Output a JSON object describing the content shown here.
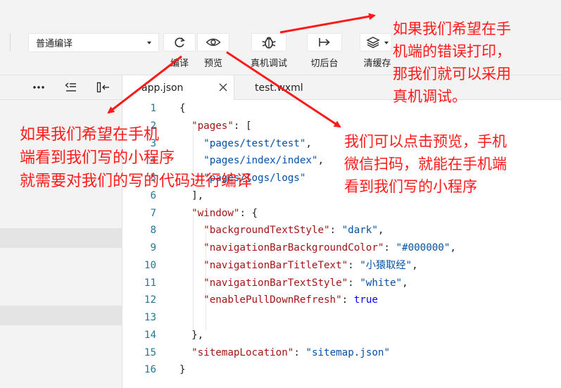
{
  "toolbar": {
    "compile_mode": "普通编译",
    "buttons": [
      {
        "id": "compile",
        "label": "编译",
        "icon": "refresh-icon"
      },
      {
        "id": "preview",
        "label": "预览",
        "icon": "eye-icon"
      },
      {
        "id": "remote_debug",
        "label": "真机调试",
        "icon": "bug-icon"
      },
      {
        "id": "background",
        "label": "切后台",
        "icon": "switch-background-icon"
      },
      {
        "id": "clear_cache",
        "label": "清缓存",
        "icon": "layers-icon"
      }
    ]
  },
  "left_panel": {
    "icons": [
      "more-icon",
      "outdent-icon",
      "collapse-panel-icon"
    ]
  },
  "tabs": [
    {
      "label": "app.json",
      "active": true
    },
    {
      "label": "test.wxml",
      "active": false
    }
  ],
  "code": [
    {
      "n": "1",
      "tokens": [
        [
          "p",
          "{"
        ]
      ]
    },
    {
      "n": "2",
      "tokens": [
        [
          "p",
          "  "
        ],
        [
          "k",
          "\"pages\""
        ],
        [
          "p",
          ": ["
        ]
      ]
    },
    {
      "n": "3",
      "tokens": [
        [
          "p",
          "    "
        ],
        [
          "s",
          "\"pages/test/test\""
        ],
        [
          "p",
          ","
        ]
      ]
    },
    {
      "n": "4",
      "tokens": [
        [
          "p",
          "    "
        ],
        [
          "s",
          "\"pages/index/index\""
        ],
        [
          "p",
          ","
        ]
      ]
    },
    {
      "n": "5",
      "tokens": [
        [
          "p",
          "    "
        ],
        [
          "s",
          "\"pages/logs/logs\""
        ]
      ]
    },
    {
      "n": "6",
      "tokens": [
        [
          "p",
          "  ],"
        ]
      ]
    },
    {
      "n": "7",
      "tokens": [
        [
          "p",
          "  "
        ],
        [
          "k",
          "\"window\""
        ],
        [
          "p",
          ": {"
        ]
      ]
    },
    {
      "n": "8",
      "tokens": [
        [
          "p",
          "    "
        ],
        [
          "k",
          "\"backgroundTextStyle\""
        ],
        [
          "p",
          ": "
        ],
        [
          "s",
          "\"dark\""
        ],
        [
          "p",
          ","
        ]
      ]
    },
    {
      "n": "9",
      "tokens": [
        [
          "p",
          "    "
        ],
        [
          "k",
          "\"navigationBarBackgroundColor\""
        ],
        [
          "p",
          ": "
        ],
        [
          "s",
          "\"#000000\""
        ],
        [
          "p",
          ","
        ]
      ]
    },
    {
      "n": "10",
      "tokens": [
        [
          "p",
          "    "
        ],
        [
          "k",
          "\"navigationBarTitleText\""
        ],
        [
          "p",
          ": "
        ],
        [
          "s",
          "\"小猿取经\""
        ],
        [
          "p",
          ","
        ]
      ]
    },
    {
      "n": "11",
      "tokens": [
        [
          "p",
          "    "
        ],
        [
          "k",
          "\"navigationBarTextStyle\""
        ],
        [
          "p",
          ": "
        ],
        [
          "s",
          "\"white\""
        ],
        [
          "p",
          ","
        ]
      ]
    },
    {
      "n": "12",
      "tokens": [
        [
          "p",
          "    "
        ],
        [
          "k",
          "\"enablePullDownRefresh\""
        ],
        [
          "p",
          ": "
        ],
        [
          "b",
          "true"
        ]
      ]
    },
    {
      "n": "13",
      "tokens": []
    },
    {
      "n": "14",
      "tokens": [
        [
          "p",
          "  },"
        ]
      ]
    },
    {
      "n": "15",
      "tokens": [
        [
          "p",
          "  "
        ],
        [
          "k",
          "\"sitemapLocation\""
        ],
        [
          "p",
          ": "
        ],
        [
          "s",
          "\"sitemap.json\""
        ]
      ]
    },
    {
      "n": "16",
      "tokens": [
        [
          "p",
          "}"
        ]
      ]
    }
  ],
  "annotations": {
    "compile_note": "如果我们希望在手机\n端看到我们写的小程序\n就需要对我们的写的代码进行编译",
    "preview_note": "我们可以点击预览，手机\n微信扫码，就能在手机端\n看到我们写的小程序",
    "debug_note": "如果我们希望在手\n机端的错误打印，\n那我们就可以采用\n真机调试。"
  },
  "colors": {
    "annotation": "#ff1a1a",
    "line_number": "#237893",
    "json_key": "#a31515",
    "json_string": "#0451a5",
    "json_bool": "#0000ff"
  }
}
